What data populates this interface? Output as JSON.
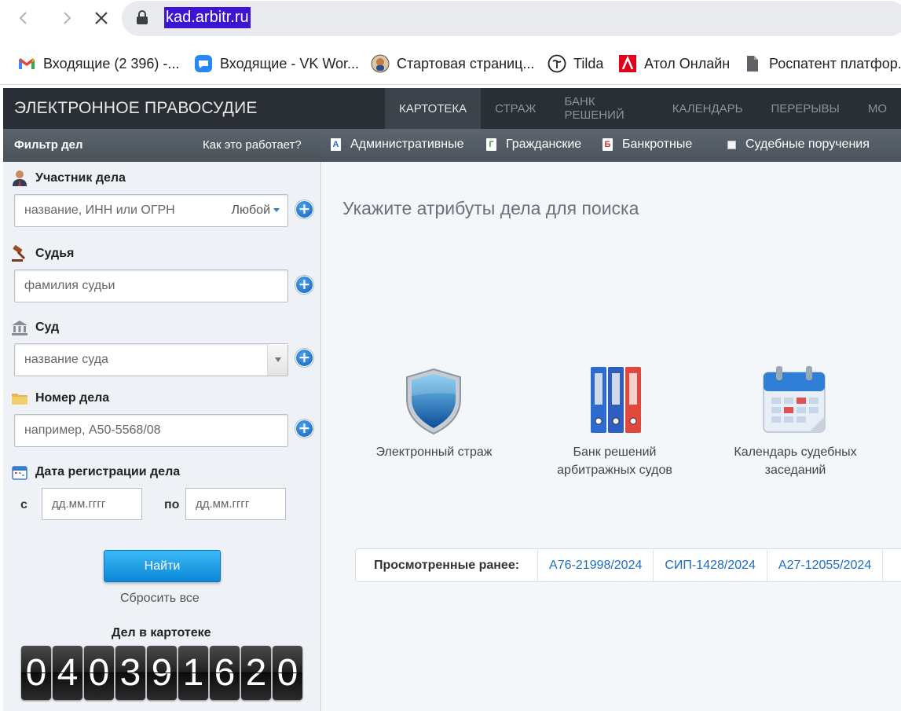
{
  "browser": {
    "url": "kad.arbitr.ru",
    "bookmarks": [
      {
        "label": "Входящие (2 396) -...",
        "icon": "gmail-icon"
      },
      {
        "label": "Входящие - VK Wor...",
        "icon": "vk-workmail-icon"
      },
      {
        "label": "Стартовая страниц...",
        "icon": "avatar-icon"
      },
      {
        "label": "Tilda",
        "icon": "tilda-icon"
      },
      {
        "label": "Атол Онлайн",
        "icon": "atol-icon"
      },
      {
        "label": "Роспатент платфор...",
        "icon": "document-icon"
      }
    ]
  },
  "header": {
    "logo": "ЭЛЕКТРОННОЕ ПРАВОСУДИЕ",
    "nav": [
      "КАРТОТЕКА",
      "СТРАЖ",
      "БАНК РЕШЕНИЙ",
      "КАЛЕНДАРЬ",
      "ПЕРЕРЫВЫ",
      "МО"
    ]
  },
  "filter_bar": {
    "title": "Фильтр дел",
    "how": "Как это работает?",
    "types": [
      {
        "letter": "А",
        "label": "Административные",
        "color": "#2b6cc4"
      },
      {
        "letter": "Г",
        "label": "Гражданские",
        "color": "#3f9a2e"
      },
      {
        "letter": "Б",
        "label": "Банкротные",
        "color": "#c8372d"
      }
    ],
    "court_orders": "Судебные поручения"
  },
  "sidebar": {
    "participant": {
      "label": "Участник дела",
      "placeholder": "название, ИНН или ОГРН",
      "any": "Любой"
    },
    "judge": {
      "label": "Судья",
      "placeholder": "фамилия судьи"
    },
    "court": {
      "label": "Суд",
      "placeholder": "название суда"
    },
    "case_number": {
      "label": "Номер дела",
      "placeholder": "например, А50-5568/08"
    },
    "date": {
      "label": "Дата регистрации дела",
      "from": "с",
      "to": "по",
      "placeholder": "дд.мм.гггг"
    },
    "find": "Найти",
    "reset": "Сбросить все",
    "count_title": "Дел в картотеке",
    "count_digits": [
      "0",
      "4",
      "0",
      "3",
      "9",
      "1",
      "6",
      "2",
      "0"
    ]
  },
  "main": {
    "title": "Укажите атрибуты дела для поиска",
    "tiles": [
      {
        "line1": "Электронный страж",
        "line2": ""
      },
      {
        "line1": "Банк решений",
        "line2": "арбитражных судов"
      },
      {
        "line1": "Календарь судебных",
        "line2": "заседаний"
      }
    ],
    "history_label": "Просмотренные ранее:",
    "history": [
      "А76-21998/2024",
      "СИП-1428/2024",
      "А27-12055/2024"
    ]
  }
}
